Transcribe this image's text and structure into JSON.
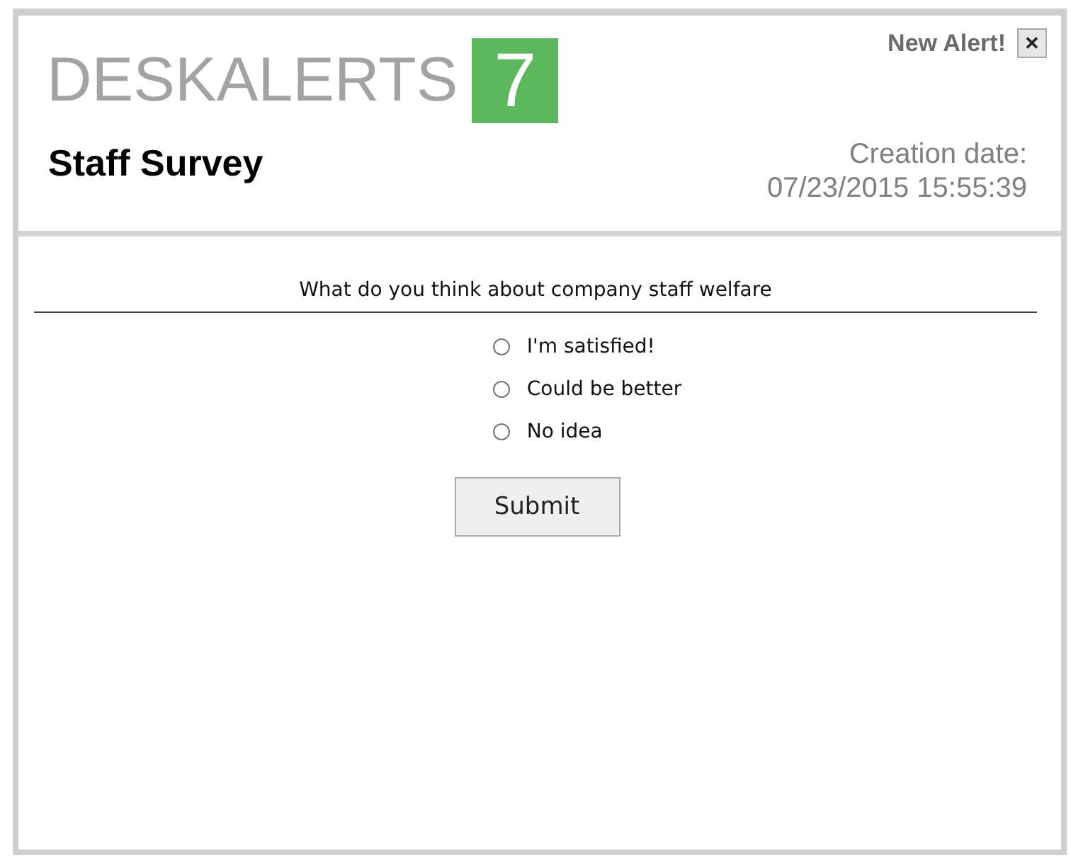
{
  "logo": {
    "text": "DESKALERTS",
    "badge": "7"
  },
  "header": {
    "notice": "New Alert!",
    "close": "✕",
    "title": "Staff Survey",
    "date_label": "Creation date:",
    "date": "07/23/2015 15:55:39"
  },
  "survey": {
    "question": "What do you think about company staff welfare",
    "options": [
      {
        "label": "I'm satisfied!",
        "selected": false
      },
      {
        "label": "Could be better",
        "selected": false
      },
      {
        "label": "No idea",
        "selected": false
      }
    ],
    "submit": "Submit"
  }
}
